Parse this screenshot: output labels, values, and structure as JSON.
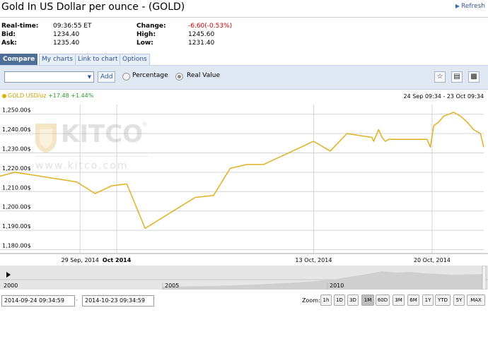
{
  "title": "Gold In US Dollar per ounce - (GOLD)",
  "refresh_label": "Refresh",
  "quote": {
    "realtime_label": "Real-time:",
    "realtime_value": "09:36:55 ET",
    "bid_label": "Bid:",
    "bid_value": "1234.40",
    "ask_label": "Ask:",
    "ask_value": "1235.40",
    "change_label": "Change:",
    "change_value": "-6.60(-0.53%)",
    "high_label": "High:",
    "high_value": "1245.60",
    "low_label": "Low:",
    "low_value": "1231.40"
  },
  "tabs": [
    {
      "label": "Compare"
    },
    {
      "label": "My charts"
    },
    {
      "label": "Link to chart"
    },
    {
      "label": "Options"
    }
  ],
  "toolbar": {
    "symbol_value": "",
    "add_label": "Add",
    "percentage_label": "Percentage",
    "real_value_label": "Real Value",
    "selected_mode": "Real Value"
  },
  "legend": {
    "symbol": "GOLD USD/oz",
    "change": "+17.48 +1.44%"
  },
  "date_range": "24 Sep 09:34 - 23 Oct 09:34",
  "watermark": {
    "brand": "KITCO",
    "url": "www.kitco.com"
  },
  "colors": {
    "line": "#e0b020",
    "grid": "#d4d4d4",
    "toolbar_bg": "#dfe8f3"
  },
  "navigator": {
    "years": [
      "2000",
      "2005",
      "2010"
    ]
  },
  "date_inputs": {
    "from": "2014-09-24 09:34:59",
    "to": "2014-10-23 09:34:59"
  },
  "zoom": {
    "label": "Zoom:",
    "buttons": [
      "1h",
      "1D",
      "3D",
      "1M",
      "60D",
      "3M",
      "6M",
      "1Y",
      "YTD",
      "5Y",
      "MAX"
    ],
    "active": "1M"
  },
  "chart_data": {
    "type": "line",
    "title": "",
    "xlabel": "",
    "ylabel": "",
    "ylim": [
      1178,
      1255
    ],
    "y_ticks": [
      1250,
      1240,
      1230,
      1220,
      1210,
      1200,
      1190,
      1180
    ],
    "y_tick_labels": [
      "1,250.00$",
      "1,240.00$",
      "1,230.00$",
      "1,220.00$",
      "1,210.00$",
      "1,200.00$",
      "1,190.00$",
      "1,180.00$"
    ],
    "x_tick_labels": [
      {
        "t": 4.8,
        "label": "29 Sep, 2014"
      },
      {
        "t": 7.0,
        "label": "Oct 2014",
        "bold": true
      },
      {
        "t": 18.8,
        "label": "13 Oct, 2014"
      },
      {
        "t": 25.9,
        "label": "20 Oct, 2014"
      }
    ],
    "x_range_days": [
      0,
      29
    ],
    "x_unit": "days from 24 Sep 2014",
    "grid": true,
    "series": [
      {
        "name": "GOLD USD/oz",
        "x": [
          0.0,
          0.9,
          4.6,
          5.7,
          6.7,
          7.6,
          8.7,
          11.7,
          12.8,
          13.8,
          14.8,
          15.8,
          18.8,
          19.8,
          20.8,
          22.3,
          22.4,
          22.7,
          22.9,
          23.1,
          23.3,
          23.5,
          25.6,
          25.8,
          26.0,
          26.3,
          26.6,
          26.9,
          27.2,
          27.6,
          28.0,
          28.4,
          28.8,
          29.0
        ],
        "y": [
          1218,
          1220,
          1215,
          1209,
          1213,
          1214,
          1191,
          1207,
          1208,
          1222,
          1224,
          1224,
          1236,
          1231,
          1240,
          1238,
          1236,
          1242,
          1238,
          1236,
          1237,
          1237,
          1237,
          1233,
          1244,
          1246,
          1249,
          1250,
          1251,
          1249,
          1246,
          1242,
          1240,
          1233
        ]
      }
    ]
  }
}
